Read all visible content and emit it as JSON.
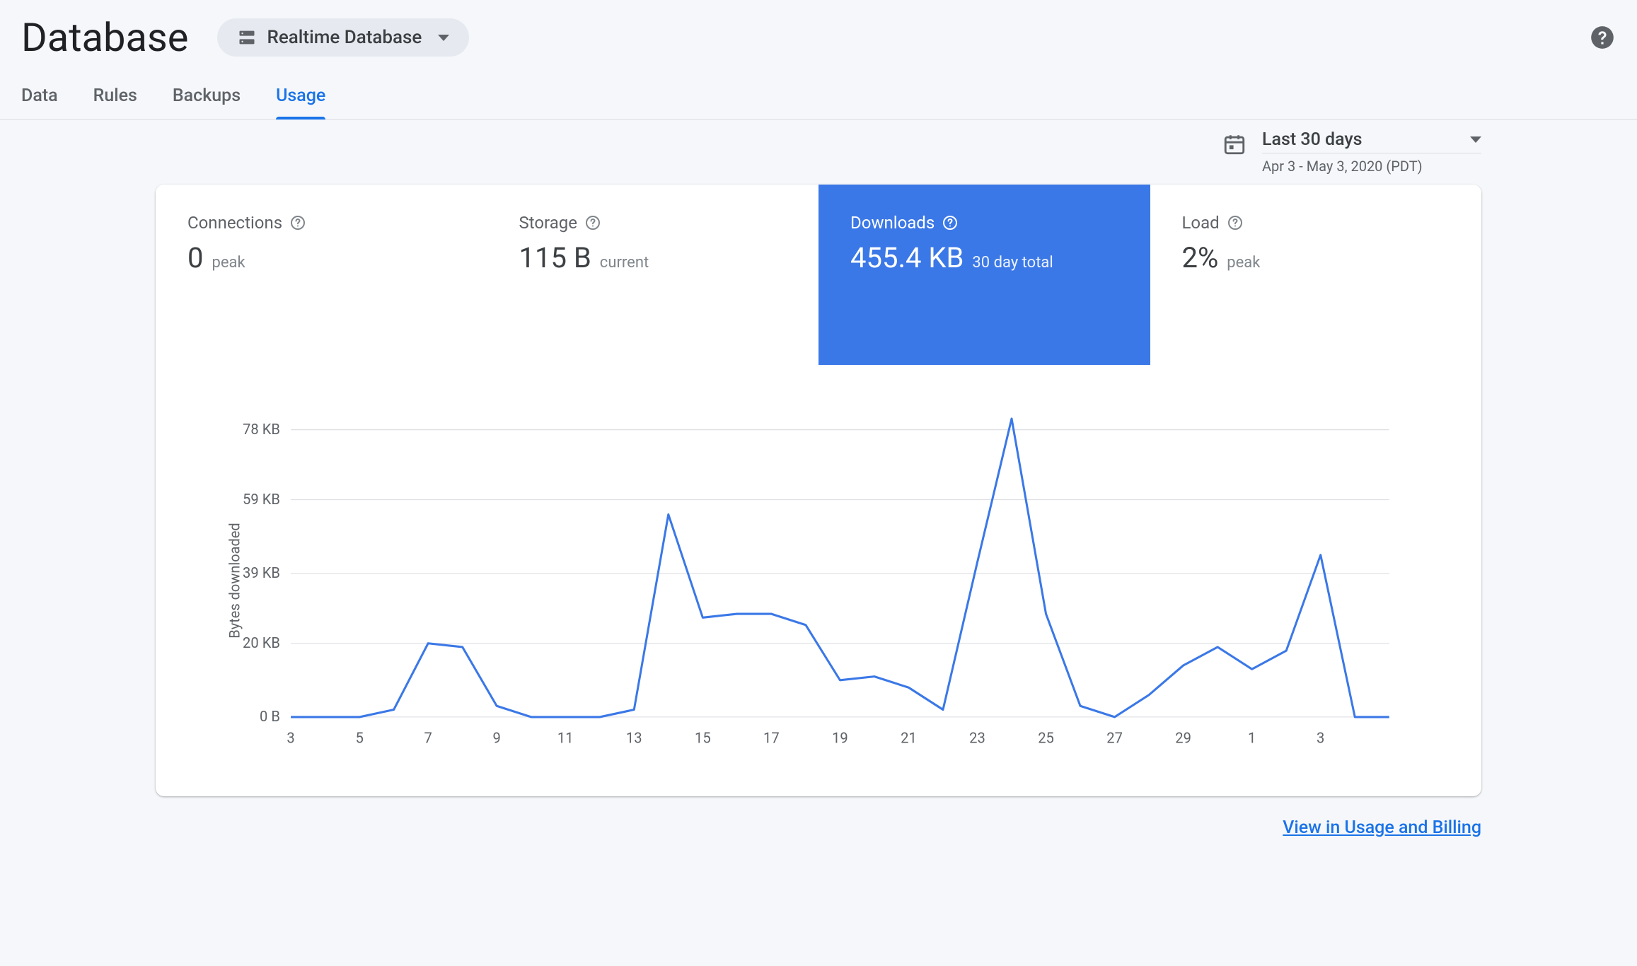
{
  "header": {
    "title": "Database",
    "selector_label": "Realtime Database"
  },
  "tabs": [
    {
      "label": "Data",
      "active": false
    },
    {
      "label": "Rules",
      "active": false
    },
    {
      "label": "Backups",
      "active": false
    },
    {
      "label": "Usage",
      "active": true
    }
  ],
  "date_picker": {
    "label": "Last 30 days",
    "range": "Apr 3 - May 3, 2020 (PDT)"
  },
  "metrics": [
    {
      "title": "Connections",
      "value": "0",
      "sub": "peak",
      "active": false
    },
    {
      "title": "Storage",
      "value": "115 B",
      "sub": "current",
      "active": false
    },
    {
      "title": "Downloads",
      "value": "455.4 KB",
      "sub": "30 day total",
      "active": true
    },
    {
      "title": "Load",
      "value": "2%",
      "sub": "peak",
      "active": false
    }
  ],
  "chart_data": {
    "type": "line",
    "ylabel": "Bytes downloaded",
    "y_ticks": [
      "0 B",
      "20 KB",
      "39 KB",
      "59 KB",
      "78 KB"
    ],
    "ylim": [
      0,
      84
    ],
    "x_ticks": [
      "3",
      "5",
      "7",
      "9",
      "11",
      "13",
      "15",
      "17",
      "19",
      "21",
      "23",
      "25",
      "27",
      "29",
      "1",
      "3"
    ],
    "x": [
      3,
      4,
      5,
      6,
      7,
      8,
      9,
      10,
      11,
      12,
      13,
      14,
      15,
      16,
      17,
      18,
      19,
      20,
      21,
      22,
      23,
      24,
      25,
      26,
      27,
      28,
      29,
      30,
      1,
      2,
      3
    ],
    "values": [
      0,
      0,
      0,
      2,
      20,
      19,
      3,
      0,
      0,
      0,
      2,
      55,
      27,
      28,
      28,
      25,
      10,
      11,
      8,
      2,
      42,
      81,
      28,
      3,
      0,
      6,
      14,
      19,
      13,
      18,
      44,
      0,
      0
    ]
  },
  "footer_link": "View in Usage and Billing"
}
